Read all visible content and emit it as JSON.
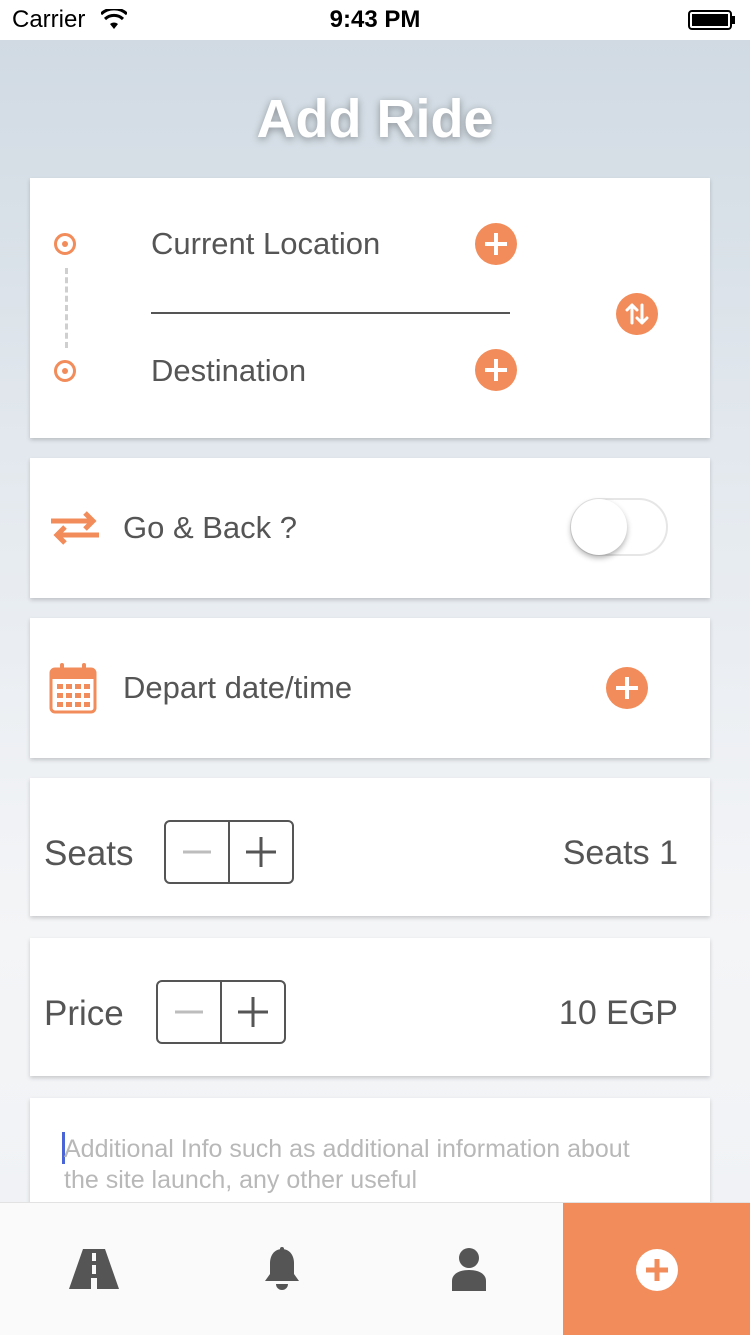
{
  "status_bar": {
    "carrier": "Carrier",
    "time": "9:43 PM"
  },
  "page": {
    "title": "Add Ride"
  },
  "route": {
    "origin_label": "Current Location",
    "destination_label": "Destination"
  },
  "go_back": {
    "label": "Go & Back ?",
    "enabled": false
  },
  "depart": {
    "label": "Depart date/time"
  },
  "seats": {
    "label": "Seats",
    "value_text": "Seats 1"
  },
  "price": {
    "label": "Price",
    "value_text": "10 EGP"
  },
  "additional_info": {
    "placeholder": "Additional Info such as additional information about the site launch, any other useful"
  },
  "tabbar": {
    "items": [
      "road-icon",
      "bell-icon",
      "user-icon",
      "add-icon"
    ],
    "active_index": 3
  },
  "colors": {
    "accent": "#f28c5a",
    "text": "#555555",
    "placeholder": "#b8b8b8"
  }
}
